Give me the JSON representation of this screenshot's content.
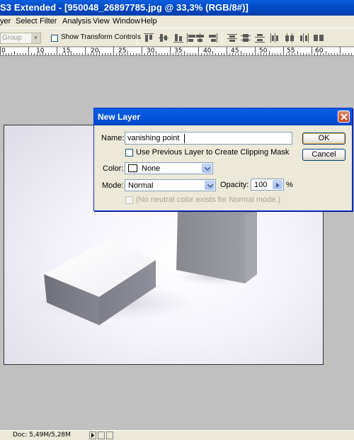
{
  "titlebar": {
    "title": "S3 Extended - [950048_26897785.jpg @ 33,3% (RGB/8#)]"
  },
  "menu": [
    "yer",
    "Select",
    "Filter",
    "Analysis",
    "View",
    "Window",
    "Help"
  ],
  "options": {
    "auto_select_value": "Group",
    "show_transform_label": "Show Transform Controls",
    "show_transform_checked": false
  },
  "ruler": {
    "labels": [
      "0",
      "10",
      "15",
      "20",
      "25",
      "30",
      "35",
      "40",
      "45",
      "50",
      "55",
      "60"
    ]
  },
  "dialog": {
    "title": "New Layer",
    "name_label": "Name:",
    "name_value": "vanishing point",
    "clipping_label": "Use Previous Layer to Create Clipping Mask",
    "clipping_checked": false,
    "color_label": "Color:",
    "color_value": "None",
    "mode_label": "Mode:",
    "mode_value": "Normal",
    "opacity_label": "Opacity:",
    "opacity_value": "100",
    "opacity_unit": "%",
    "neutral_label": "(No neutral color exists for Normal mode.)",
    "ok_label": "OK",
    "cancel_label": "Cancel"
  },
  "statusbar": {
    "doc_info": "Doc: 5,49M/5,28M"
  },
  "colors": {
    "title_bar": "#0349c4",
    "chrome": "#ece9d8",
    "workspace": "#c0c0c0",
    "close_button": "#cc3d12"
  },
  "icons": [
    "close-icon",
    "dropdown-arrow-icon",
    "slider-arrow-icon",
    "align-top-icon",
    "align-vcenter-icon",
    "align-bottom-icon",
    "align-left-icon",
    "align-hcenter-icon",
    "align-right-icon",
    "distribute-top-icon",
    "distribute-vcenter-icon",
    "distribute-bottom-icon",
    "distribute-left-icon",
    "distribute-hcenter-icon",
    "distribute-right-icon",
    "play-icon"
  ]
}
